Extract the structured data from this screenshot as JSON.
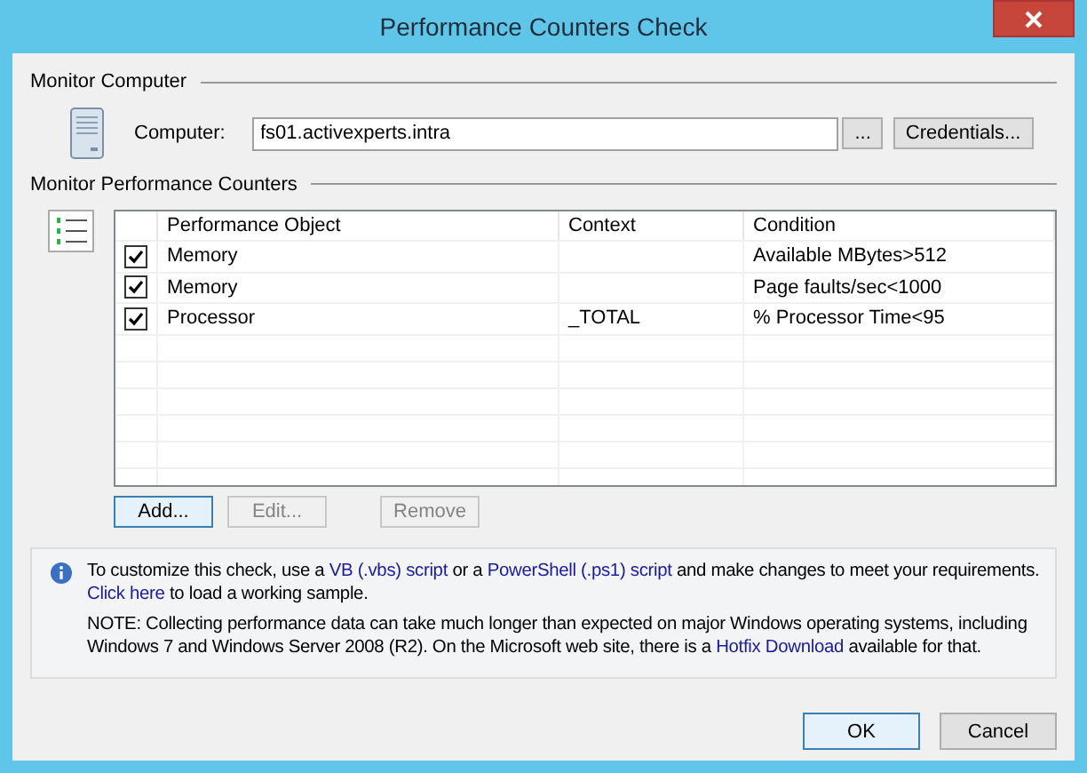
{
  "window": {
    "title": "Performance Counters Check"
  },
  "monitor_computer": {
    "heading": "Monitor Computer",
    "label": "Computer:",
    "value": "fs01.activexperts.intra",
    "browse_button": "...",
    "credentials_button": "Credentials..."
  },
  "counters": {
    "heading": "Monitor Performance Counters",
    "columns": [
      "Performance Object",
      "Context",
      "Condition"
    ],
    "rows": [
      {
        "checked": true,
        "object": "Memory",
        "context": "",
        "condition": "Available MBytes>512"
      },
      {
        "checked": true,
        "object": "Memory",
        "context": "",
        "condition": "Page faults/sec<1000"
      },
      {
        "checked": true,
        "object": "Processor",
        "context": "_TOTAL",
        "condition": "% Processor Time<95"
      }
    ],
    "buttons": [
      {
        "label": "Add...",
        "disabled": false
      },
      {
        "label": "Edit...",
        "disabled": true
      },
      {
        "label": "Remove",
        "disabled": true
      }
    ]
  },
  "info": {
    "paragraphs": [
      [
        {
          "text": "To customize this check, use a ",
          "link": false
        },
        {
          "text": "VB (.vbs) script",
          "link": true
        },
        {
          "text": " or a ",
          "link": false
        },
        {
          "text": "PowerShell (.ps1) script",
          "link": true
        },
        {
          "text": " and make changes to meet your requirements. ",
          "link": false
        },
        {
          "text": "Click here",
          "link": true
        },
        {
          "text": " to load a working sample.",
          "link": false
        }
      ],
      [
        {
          "text": "NOTE: Collecting performance data can take much longer than expected on major Windows operating systems, including Windows 7 and Windows Server 2008 (R2). On the Microsoft web site, there is a ",
          "link": false
        },
        {
          "text": "Hotfix Download",
          "link": true
        },
        {
          "text": " available for that.",
          "link": false
        }
      ]
    ]
  },
  "dialog_buttons": [
    "OK",
    "Cancel"
  ]
}
